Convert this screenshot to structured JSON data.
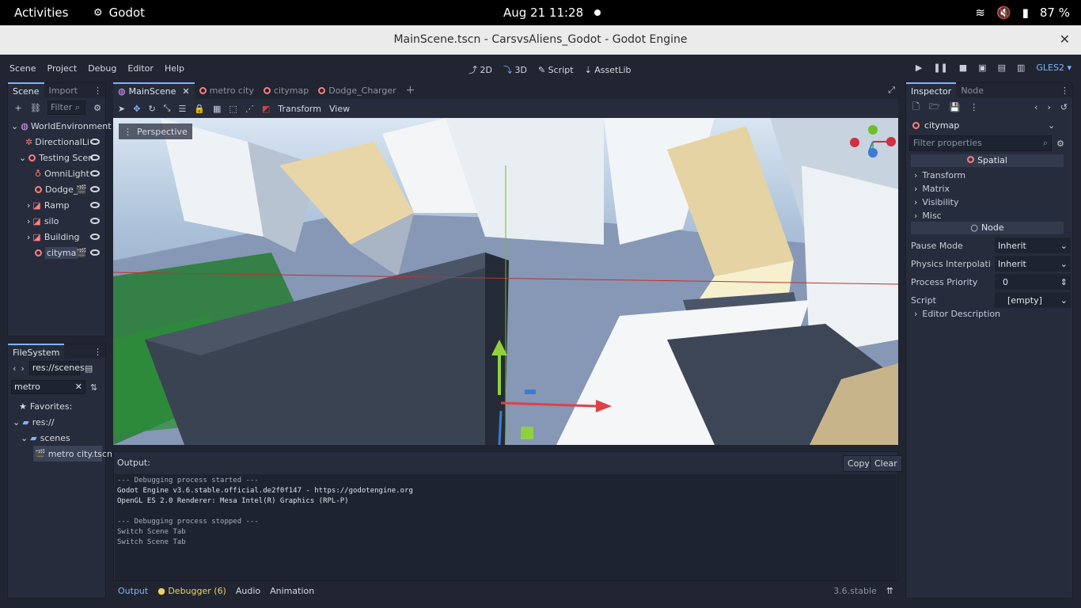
{
  "system_bar": {
    "activities": "Activities",
    "app": "Godot",
    "clock": "Aug 21  11:28",
    "battery": "87 %"
  },
  "window": {
    "title": "MainScene.tscn - CarsvsAliens_Godot - Godot Engine"
  },
  "menu": {
    "items": [
      "Scene",
      "Project",
      "Debug",
      "Editor",
      "Help"
    ]
  },
  "modes": {
    "two_d": "2D",
    "three_d": "3D",
    "script": "Script",
    "assetlib": "AssetLib"
  },
  "renderer": "GLES2",
  "scene_dock": {
    "tab_scene": "Scene",
    "tab_import": "Import",
    "filter_placeholder": "Filter",
    "nodes": [
      "WorldEnvironment",
      "DirectionalLi",
      "Testing Scen",
      "OmniLight",
      "Dodge_",
      "Ramp",
      "silo",
      "Building",
      "cityma"
    ]
  },
  "filesystem": {
    "tab": "FileSystem",
    "path": "res://scenes",
    "search": "metro",
    "favorites": "Favorites:",
    "res": "res://",
    "scenes": "scenes",
    "file": "metro city.tscn"
  },
  "editor_tabs": [
    "MainScene",
    "metro city",
    "citymap",
    "Dodge_Charger"
  ],
  "viewport_toolbar": {
    "transform": "Transform",
    "view": "View"
  },
  "viewport": {
    "perspective": "Perspective"
  },
  "output": {
    "label": "Output:",
    "copy": "Copy",
    "clear": "Clear",
    "lines": [
      "--- Debugging process started ---",
      "Godot Engine v3.6.stable.official.de2f0f147 - https://godotengine.org",
      "OpenGL ES 2.0 Renderer: Mesa Intel(R) Graphics (RPL-P)",
      "",
      "--- Debugging process stopped ---",
      "Switch Scene Tab",
      "Switch Scene Tab"
    ]
  },
  "bottom_tabs": {
    "output": "Output",
    "debugger": "Debugger (6)",
    "audio": "Audio",
    "animation": "Animation",
    "version": "3.6.stable"
  },
  "inspector": {
    "tab_inspector": "Inspector",
    "tab_node": "Node",
    "object": "citymap",
    "filter_placeholder": "Filter properties",
    "spatial": "Spatial",
    "groups": [
      "Transform",
      "Matrix",
      "Visibility",
      "Misc"
    ],
    "node": "Node",
    "pause_mode_label": "Pause Mode",
    "pause_mode_value": "Inherit",
    "physics_label": "Physics Interpolatio",
    "physics_value": "Inherit",
    "priority_label": "Process Priority",
    "priority_value": "0",
    "script_label": "Script",
    "script_value": "[empty]",
    "editor_desc": "Editor Description"
  },
  "colors": {
    "accent": "#7fb3ff",
    "bg": "#202531",
    "panel": "#262c3b"
  }
}
